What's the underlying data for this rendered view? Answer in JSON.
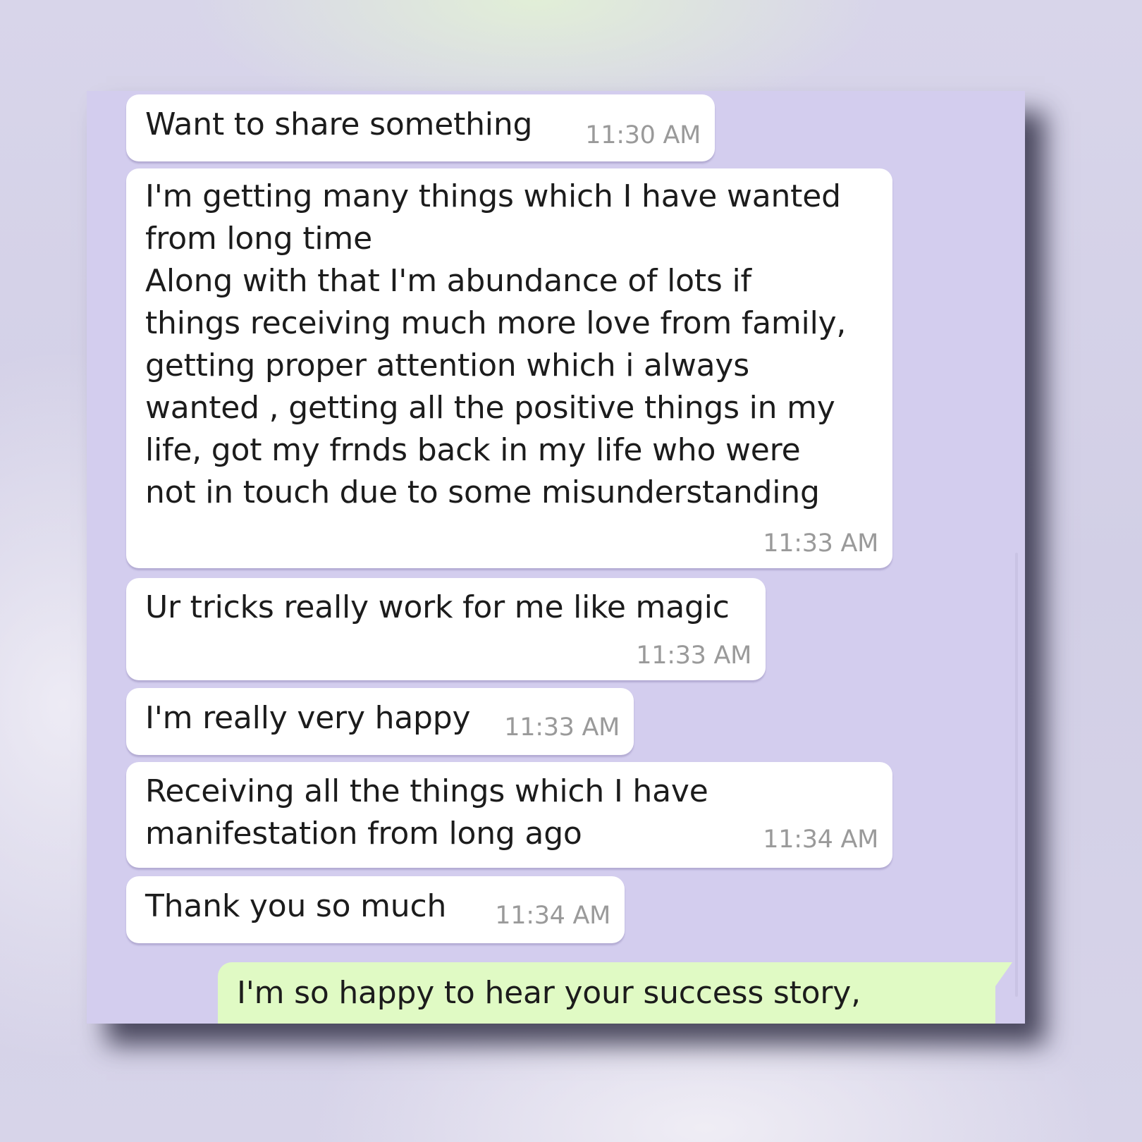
{
  "messages": [
    {
      "text": "Want to share something",
      "time": "11:30 AM"
    },
    {
      "text": "I'm getting many things which I have wanted\nfrom long time\nAlong with that I'm abundance of lots if\nthings receiving much more love from family,\ngetting proper attention which i always\nwanted , getting all the positive things in my\nlife,  got my frnds back in my life who were\nnot in touch due to some misunderstanding",
      "time": "11:33 AM"
    },
    {
      "text": "Ur tricks really work for me like magic",
      "time": "11:33 AM"
    },
    {
      "text": "I'm really very happy",
      "time": "11:33 AM"
    },
    {
      "text": "Receiving all the things which I have\nmanifestation from long ago",
      "time": "11:34 AM"
    },
    {
      "text": "Thank you so much",
      "time": "11:34 AM"
    }
  ],
  "reply": {
    "text": "I'm so happy to hear your success story,"
  },
  "colors": {
    "chat_background": "#d3cdee",
    "incoming_bubble": "#ffffff",
    "outgoing_bubble": "#e0fac4",
    "timestamp": "#9a9a9a"
  }
}
